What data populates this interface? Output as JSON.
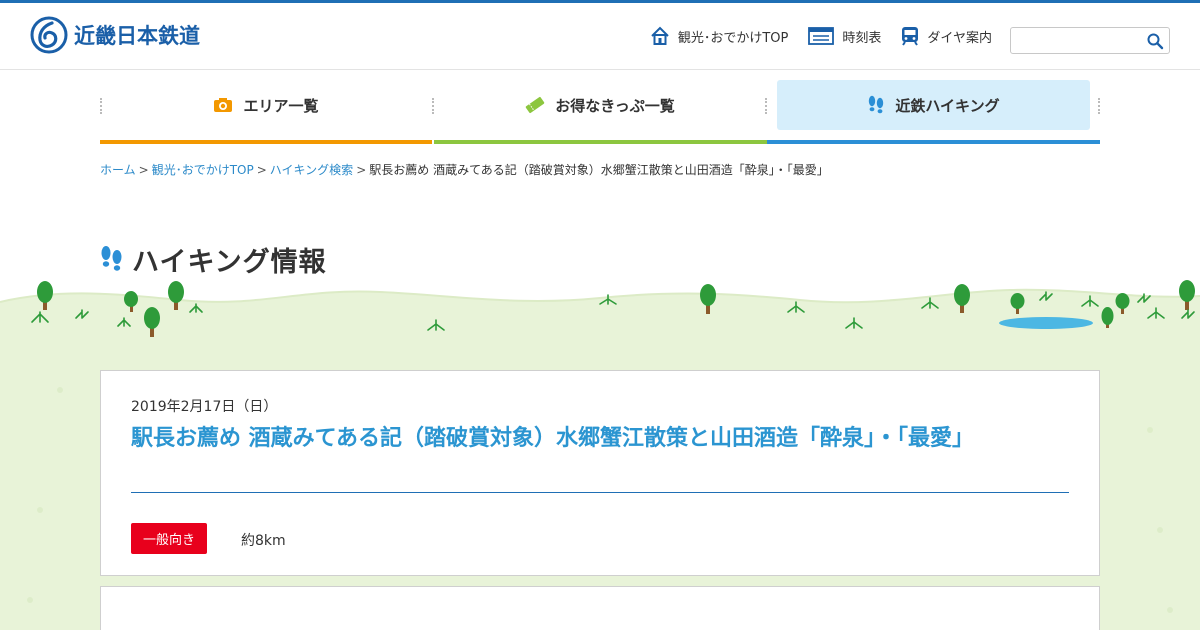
{
  "header": {
    "logo_text": "近畿日本鉄道",
    "links": [
      {
        "label": "観光･おでかけTOP",
        "icon": "home-icon"
      },
      {
        "label": "時刻表",
        "icon": "timetable-icon"
      },
      {
        "label": "ダイヤ案内",
        "icon": "train-icon"
      }
    ],
    "search": {
      "value": "",
      "placeholder": ""
    }
  },
  "nav": {
    "items": [
      {
        "label": "エリア一覧",
        "icon": "camera-icon",
        "accent": "#f39800"
      },
      {
        "label": "お得なきっぷ一覧",
        "icon": "ticket-icon",
        "accent": "#8cc63f"
      },
      {
        "label": "近鉄ハイキング",
        "icon": "footprints-icon",
        "accent": "#2b8fd6",
        "active": true
      }
    ]
  },
  "breadcrumb": {
    "items": [
      "ホーム",
      "観光･おでかけTOP",
      "ハイキング検索"
    ],
    "current": "駅長お薦め 酒蔵みてある記（踏破賞対象）水郷蟹江散策と山田酒造「酔泉」・「最愛」"
  },
  "page": {
    "title": "ハイキング情報"
  },
  "event": {
    "date": "2019年2月17日（日）",
    "title": "駅長お薦め 酒蔵みてある記（踏破賞対象）水郷蟹江散策と山田酒造「酔泉」・「最愛」",
    "level_badge": "一般向き",
    "distance": "約8km"
  },
  "colors": {
    "brand": "#1a5fa8",
    "title_blue": "#2b95d1",
    "badge_red": "#e8001c",
    "grass": "#e8f3d8"
  }
}
